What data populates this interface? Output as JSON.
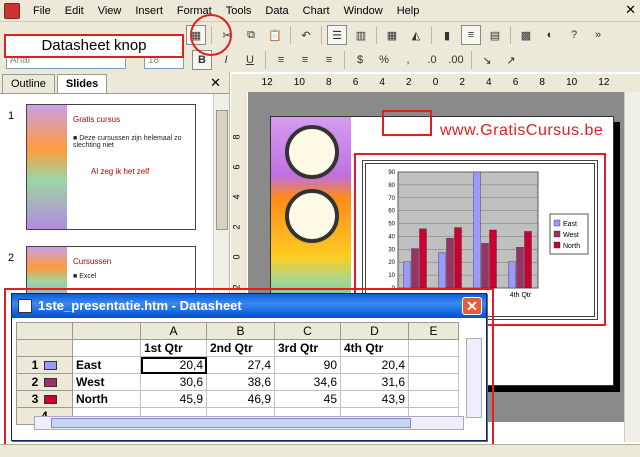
{
  "menu": {
    "file": "File",
    "edit": "Edit",
    "view": "View",
    "insert": "Insert",
    "format": "Format",
    "tools": "Tools",
    "data": "Data",
    "chart": "Chart",
    "window": "Window",
    "help": "Help"
  },
  "callout": {
    "label": "Datasheet knop"
  },
  "toolbar": {
    "font": "Arial",
    "size": "18"
  },
  "panel": {
    "tabs": [
      "Outline",
      "Slides"
    ],
    "slides": [
      {
        "num": "1",
        "title": "Gratis cursus",
        "body": "Deze cursussen zijn helemaal zo slechting niet",
        "extra": "Al zeg ik het zelf"
      },
      {
        "num": "2",
        "title": "Cursussen",
        "body": "Excel"
      }
    ]
  },
  "ruler_top": [
    "12",
    "10",
    "8",
    "6",
    "4",
    "2",
    "0",
    "2",
    "4",
    "6",
    "8",
    "10",
    "12"
  ],
  "ruler_left": [
    "8",
    "6",
    "4",
    "2",
    "0",
    "2"
  ],
  "brand": "www.GratisCursus.be",
  "chart_data": {
    "type": "bar",
    "categories": [
      "1st Qtr",
      "2nd Qtr",
      "3rd Qtr",
      "4th Qtr"
    ],
    "series": [
      {
        "name": "East",
        "values": [
          20.4,
          27.4,
          90,
          20.4
        ],
        "color": "#9999ff"
      },
      {
        "name": "West",
        "values": [
          30.6,
          38.6,
          34.6,
          31.6
        ],
        "color": "#993366"
      },
      {
        "name": "North",
        "values": [
          45.9,
          46.9,
          45,
          43.9
        ],
        "color": "#cc0033"
      }
    ],
    "ylim": [
      0,
      90
    ],
    "yticks": [
      "90",
      "80",
      "70",
      "60",
      "50",
      "40",
      "30",
      "20",
      "10",
      "0"
    ],
    "xtick_visible": [
      "4th Qtr"
    ],
    "legend": "right",
    "grid": true
  },
  "datasheet": {
    "title": "1ste_presentatie.htm - Datasheet",
    "columns": [
      "A",
      "B",
      "C",
      "D",
      "E"
    ],
    "headers": [
      "1st Qtr",
      "2nd Qtr",
      "3rd Qtr",
      "4th Qtr"
    ],
    "rows": [
      {
        "num": "1",
        "label": "East",
        "values": [
          "20,4",
          "27,4",
          "90",
          "20,4"
        ]
      },
      {
        "num": "2",
        "label": "West",
        "values": [
          "30,6",
          "38,6",
          "34,6",
          "31,6"
        ]
      },
      {
        "num": "3",
        "label": "North",
        "values": [
          "45,9",
          "46,9",
          "45",
          "43,9"
        ]
      },
      {
        "num": "4",
        "label": "",
        "values": [
          "",
          "",
          "",
          ""
        ]
      }
    ]
  }
}
